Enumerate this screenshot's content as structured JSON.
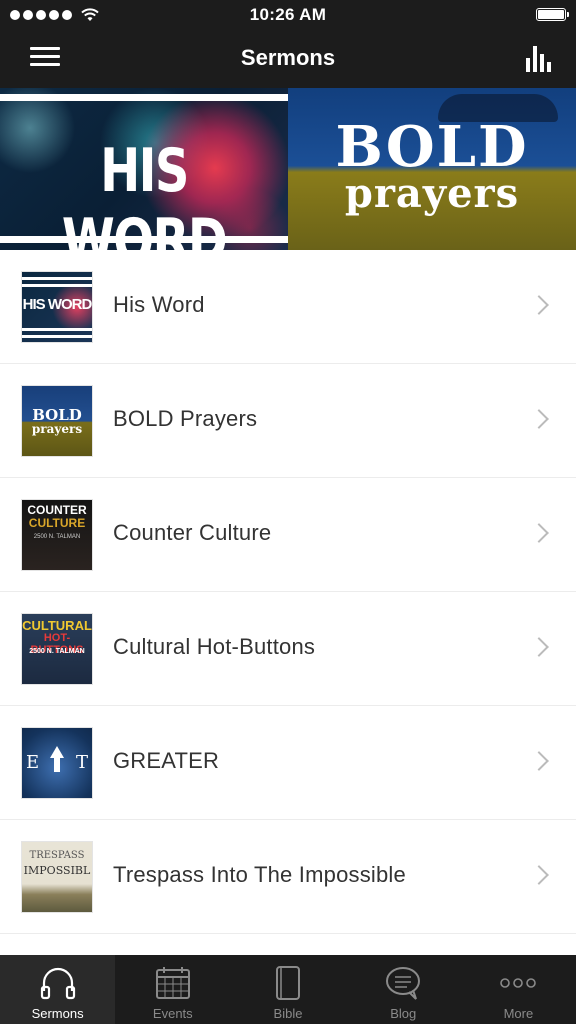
{
  "status_bar": {
    "time": "10:26 AM"
  },
  "nav": {
    "title": "Sermons",
    "menu_icon": "hamburger-menu-icon",
    "chart_icon": "bar-chart-icon"
  },
  "banner": {
    "left_title": "HIS WORD",
    "right_title": "BOLD",
    "right_subtitle": "prayers"
  },
  "sermons": [
    {
      "label": "His Word",
      "thumb_text": [
        "HIS WORD"
      ]
    },
    {
      "label": "BOLD Prayers",
      "thumb_text": [
        "BOLD",
        "prayers"
      ]
    },
    {
      "label": "Counter Culture",
      "thumb_text": [
        "COUNTER",
        "CULTURE",
        "2500 N. TALMAN"
      ]
    },
    {
      "label": "Cultural Hot-Buttons",
      "thumb_text": [
        "CULTURAL",
        "HOT-BUTTONS",
        "2500 N. TALMAN"
      ]
    },
    {
      "label": "GREATER",
      "thumb_text": [
        "E",
        "T"
      ]
    },
    {
      "label": "Trespass Into The Impossible",
      "thumb_text": [
        "TRESPASS",
        "IMPOSSIBL"
      ]
    }
  ],
  "tabs": [
    {
      "label": "Sermons",
      "icon": "headphones-icon",
      "active": true
    },
    {
      "label": "Events",
      "icon": "calendar-icon",
      "active": false
    },
    {
      "label": "Bible",
      "icon": "book-icon",
      "active": false
    },
    {
      "label": "Blog",
      "icon": "speech-bubble-icon",
      "active": false
    },
    {
      "label": "More",
      "icon": "more-dots-icon",
      "active": false
    }
  ],
  "colors": {
    "bar_background": "#1c1c1c",
    "active_tab_background": "#2a2a2a",
    "inactive_tab_label": "#8a8a8a"
  }
}
